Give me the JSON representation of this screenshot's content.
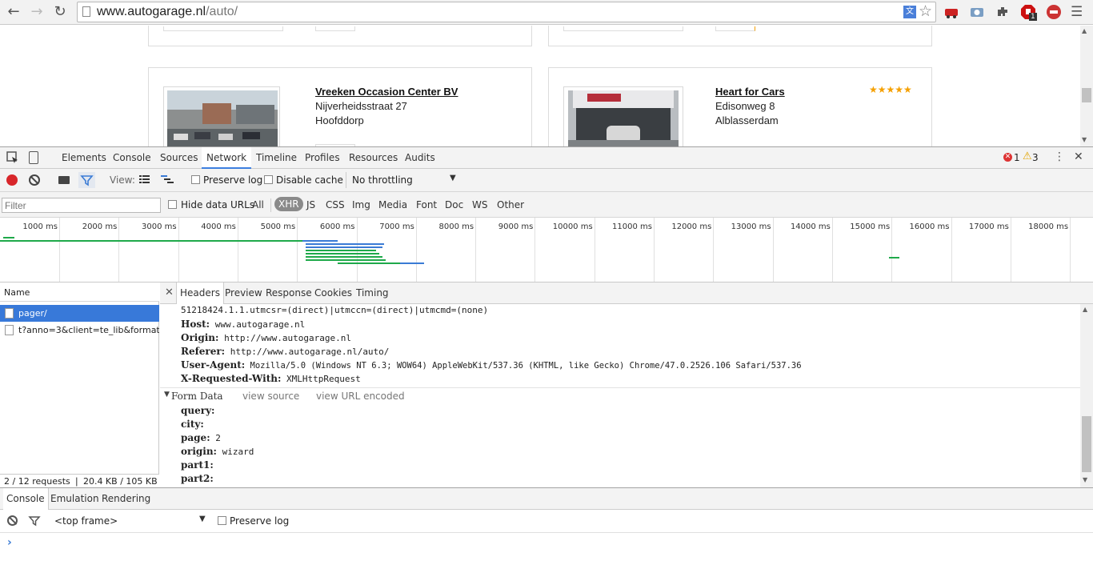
{
  "browser": {
    "url_host": "www.autogarage.nl",
    "url_path": "/auto/",
    "icons": [
      "back-icon",
      "forward-icon",
      "reload-icon",
      "page-icon",
      "translate-icon",
      "star-icon",
      "extension-train-icon",
      "camera-icon",
      "puzzle-icon",
      "adblock-icon",
      "record-icon",
      "menu-icon"
    ],
    "adblock_count": "1"
  },
  "page": {
    "dealers": [
      {
        "name": "Vreeken Occasion Center BV",
        "street": "Nijverheidsstraat 27",
        "city": "Hoofddorp",
        "rating": 0
      },
      {
        "name": "Heart for Cars",
        "street": "Edisonweg 8",
        "city": "Alblasserdam",
        "rating": 5,
        "stars": "★★★★★"
      }
    ]
  },
  "devtools": {
    "tabs": [
      "Elements",
      "Console",
      "Sources",
      "Network",
      "Timeline",
      "Profiles",
      "Resources",
      "Audits"
    ],
    "active_tab": "Network",
    "error_count": "1",
    "warning_count": "3",
    "toolbar": {
      "view_label": "View:",
      "preserve_log": "Preserve log",
      "disable_cache": "Disable cache",
      "throttling": "No throttling"
    },
    "filter": {
      "placeholder": "Filter",
      "hide_data_urls": "Hide data URLs",
      "types": [
        "All",
        "XHR",
        "JS",
        "CSS",
        "Img",
        "Media",
        "Font",
        "Doc",
        "WS",
        "Other"
      ],
      "selected_type": "XHR"
    },
    "timeline_ticks": [
      "1000 ms",
      "2000 ms",
      "3000 ms",
      "4000 ms",
      "5000 ms",
      "6000 ms",
      "7000 ms",
      "8000 ms",
      "9000 ms",
      "10000 ms",
      "11000 ms",
      "12000 ms",
      "13000 ms",
      "14000 ms",
      "15000 ms",
      "16000 ms",
      "17000 ms",
      "18000 ms"
    ],
    "requests": {
      "column": "Name",
      "rows": [
        "pager/",
        "t?anno=3&client=te_lib&format=..."
      ],
      "status": "2 / 12 requests  ❘  20.4 KB / 105 KB ..."
    },
    "detail": {
      "tabs": [
        "Headers",
        "Preview",
        "Response",
        "Cookies",
        "Timing"
      ],
      "active_tab": "Headers",
      "cookie_tail": "51218424.1.1.utmcsr=(direct)|utmccn=(direct)|utmcmd=(none)",
      "headers": [
        {
          "key": "Host:",
          "value": "www.autogarage.nl"
        },
        {
          "key": "Origin:",
          "value": "http://www.autogarage.nl"
        },
        {
          "key": "Referer:",
          "value": "http://www.autogarage.nl/auto/"
        },
        {
          "key": "User-Agent:",
          "value": "Mozilla/5.0 (Windows NT 6.3; WOW64) AppleWebKit/537.36 (KHTML, like Gecko) Chrome/47.0.2526.106 Safari/537.36"
        },
        {
          "key": "X-Requested-With:",
          "value": "XMLHttpRequest"
        }
      ],
      "form_data_title": "Form Data",
      "view_source": "view source",
      "view_url_encoded": "view URL encoded",
      "form_data": [
        {
          "key": "query:",
          "value": ""
        },
        {
          "key": "city:",
          "value": ""
        },
        {
          "key": "page:",
          "value": "2"
        },
        {
          "key": "origin:",
          "value": "wizard"
        },
        {
          "key": "part1:",
          "value": ""
        },
        {
          "key": "part2:",
          "value": ""
        }
      ]
    },
    "drawer": {
      "tabs": [
        "Console",
        "Emulation",
        "Rendering"
      ],
      "active_tab": "Console",
      "frame": "<top frame>",
      "preserve_log": "Preserve log",
      "prompt": "›"
    }
  }
}
